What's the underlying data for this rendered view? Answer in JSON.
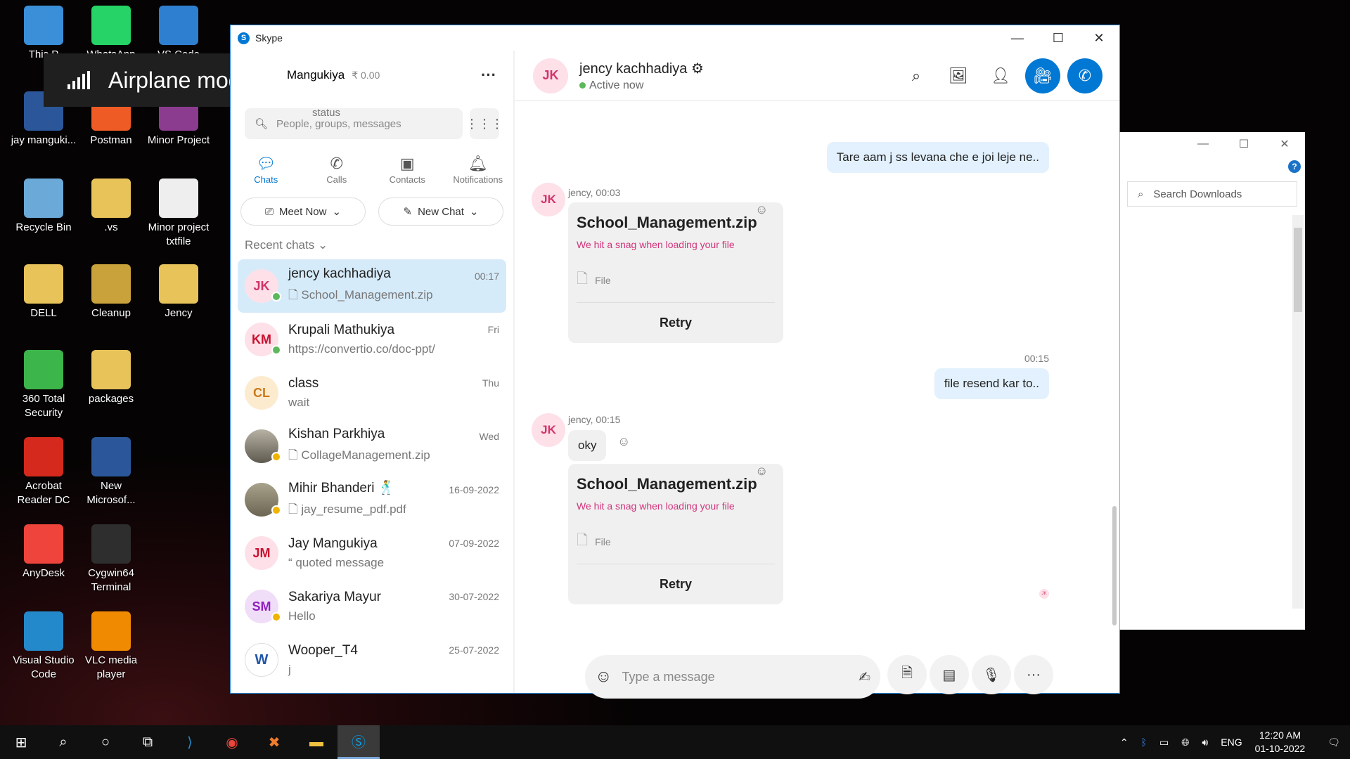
{
  "desktop": {
    "icons": [
      {
        "label": "This P",
        "icon": "this-pc-icon",
        "color": "#3a8fd8"
      },
      {
        "label": "WhatsApp",
        "icon": "whatsapp-icon",
        "color": "#25d366"
      },
      {
        "label": "VS Code",
        "icon": "download-arrow-icon",
        "color": "#2f7fd0"
      },
      {
        "label": "jay manguki...",
        "icon": "word-doc-icon",
        "color": "#2b579a"
      },
      {
        "label": "Postman",
        "icon": "postman-icon",
        "color": "#ef5b25"
      },
      {
        "label": "Minor Project",
        "icon": "winrar-icon",
        "color": "#8b3c8f"
      },
      {
        "label": "Recycle Bin",
        "icon": "recycle-bin-icon",
        "color": "#6aa9d8"
      },
      {
        "label": ".vs",
        "icon": "folder-icon",
        "color": "#e8c35a"
      },
      {
        "label": "Minor project txtfile",
        "icon": "text-file-icon",
        "color": "#eeeeee"
      },
      {
        "label": "DELL",
        "icon": "user-folder-icon",
        "color": "#e8c35a"
      },
      {
        "label": "Cleanup",
        "icon": "broom-icon",
        "color": "#c9a23b"
      },
      {
        "label": "Jency",
        "icon": "folder-icon",
        "color": "#e8c35a"
      },
      {
        "label": "360 Total Security",
        "icon": "plus-shield-icon",
        "color": "#3cb54a"
      },
      {
        "label": "packages",
        "icon": "folder-icon",
        "color": "#e8c35a"
      },
      {
        "label": "Acrobat Reader DC",
        "icon": "acrobat-icon",
        "color": "#d4291c"
      },
      {
        "label": "New Microsof...",
        "icon": "word-doc-icon",
        "color": "#2b579a"
      },
      {
        "label": "AnyDesk",
        "icon": "anydesk-icon",
        "color": "#ef443b"
      },
      {
        "label": "Cygwin64 Terminal",
        "icon": "terminal-icon",
        "color": "#2e2e2e"
      },
      {
        "label": "Visual Studio Code",
        "icon": "vscode-icon",
        "color": "#2489ca"
      },
      {
        "label": "VLC media player",
        "icon": "vlc-cone-icon",
        "color": "#f08a00"
      }
    ],
    "airplane_toast": "Airplane mode off"
  },
  "skype": {
    "title": "Skype",
    "profile": {
      "name": "Jay Mangukiya",
      "name_visible": "Mangukiya",
      "credit": "₹ 0.00",
      "status": "status"
    },
    "search_placeholder": "People, groups, messages",
    "tabs": [
      {
        "label": "Chats",
        "icon": "chat-bubble-icon"
      },
      {
        "label": "Calls",
        "icon": "phone-icon"
      },
      {
        "label": "Contacts",
        "icon": "contacts-icon"
      },
      {
        "label": "Notifications",
        "icon": "bell-icon"
      }
    ],
    "meet_now": "Meet Now",
    "new_chat": "New Chat",
    "recent_label": "Recent chats",
    "chats": [
      {
        "initials": "JK",
        "name": "jency kachhadiya",
        "preview": "School_Management.zip",
        "time": "00:17",
        "presence": "online"
      },
      {
        "initials": "KM",
        "name": "Krupali Mathukiya",
        "preview": "https://convertio.co/doc-ppt/",
        "time": "Fri",
        "presence": "online"
      },
      {
        "initials": "CL",
        "name": "class",
        "preview": "wait",
        "time": "Thu",
        "presence": "group"
      },
      {
        "initials": "",
        "name": "Kishan Parkhiya",
        "preview": "CollageManagement.zip",
        "time": "Wed",
        "presence": "away"
      },
      {
        "initials": "",
        "name": "Mihir Bhanderi 🕺",
        "preview": "jay_resume_pdf.pdf",
        "time": "16-09-2022",
        "presence": "away"
      },
      {
        "initials": "JM",
        "name": "Jay Mangukiya",
        "preview": "quoted message",
        "time": "07-09-2022",
        "presence": "none"
      },
      {
        "initials": "SM",
        "name": "Sakariya Mayur",
        "preview": "Hello",
        "time": "30-07-2022",
        "presence": "away"
      },
      {
        "initials": "W",
        "name": "Wooper_T4",
        "preview": "j",
        "time": "25-07-2022",
        "presence": "none"
      }
    ],
    "conversation": {
      "initials": "JK",
      "name": "jency kachhadiya",
      "status": "Active now",
      "messages": {
        "out1": "Tare aam j ss levana che e joi leje ne..",
        "meta1": "jency, 00:03",
        "file1_name": "School_Management.zip",
        "file_error": "We hit a snag when loading your file",
        "file_type": "File",
        "retry": "Retry",
        "time2": "00:15",
        "out2": "file resend kar to..",
        "meta2": "jency, 00:15",
        "in1": "oky",
        "file2_name": "School_Management.zip",
        "seen_initials": "JK"
      },
      "composer_placeholder": "Type a message"
    }
  },
  "downloads": {
    "search_placeholder": "Search Downloads",
    "help": "?"
  },
  "taskbar": {
    "lang": "ENG",
    "time": "12:20 AM",
    "date": "01-10-2022"
  }
}
